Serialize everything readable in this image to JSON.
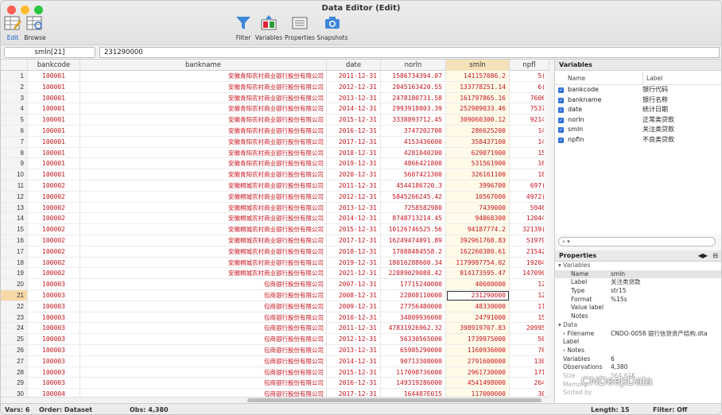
{
  "window": {
    "title": "Data Editor (Edit)"
  },
  "colors": {
    "accent": "#1a5fd0",
    "data_text": "#c8141e",
    "current_row": "#f7d9a8"
  },
  "toolbar": {
    "edit": "Edit",
    "browse": "Browse",
    "filter": "Filter",
    "variables": "Variables",
    "properties": "Properties",
    "snapshots": "Snapshots"
  },
  "cmd": {
    "varname": "smln[21]",
    "value": "231290000"
  },
  "grid": {
    "headers": [
      "bankcode",
      "bankname",
      "date",
      "norln",
      "smln",
      "npfl"
    ],
    "rows": [
      [
        "1",
        "100001",
        "安徽青阳农村商业银行股份有限公司",
        "2011-12-31",
        "1586734394.07",
        "141157086.2",
        "5("
      ],
      [
        "2",
        "100001",
        "安徽青阳农村商业银行股份有限公司",
        "2012-12-31",
        "2045163420.55",
        "133778251.14",
        "6("
      ],
      [
        "3",
        "100001",
        "安徽青阳农村商业银行股份有限公司",
        "2013-12-31",
        "2478180731.58",
        "161797865.16",
        "7606"
      ],
      [
        "4",
        "100001",
        "安徽青阳农村商业银行股份有限公司",
        "2014-12-31",
        "2993918803.39",
        "252989033.46",
        "7537"
      ],
      [
        "5",
        "100001",
        "安徽青阳农村商业银行股份有限公司",
        "2015-12-31",
        "3338893712.45",
        "309060300.12",
        "9214"
      ],
      [
        "6",
        "100001",
        "安徽青阳农村商业银行股份有限公司",
        "2016-12-31",
        "3747202700",
        "286625200",
        "14"
      ],
      [
        "7",
        "100001",
        "安徽青阳农村商业银行股份有限公司",
        "2017-12-31",
        "4153436000",
        "358437100",
        "14"
      ],
      [
        "8",
        "100001",
        "安徽青阳农村商业银行股份有限公司",
        "2018-12-31",
        "4281040200",
        "629071900",
        "15"
      ],
      [
        "9",
        "100001",
        "安徽青阳农村商业银行股份有限公司",
        "2019-12-31",
        "4866421800",
        "531561900",
        "16"
      ],
      [
        "10",
        "100001",
        "安徽青阳农村商业银行股份有限公司",
        "2020-12-31",
        "5607421300",
        "326161100",
        "18"
      ],
      [
        "11",
        "100002",
        "安徽桐城农村商业银行股份有限公司",
        "2011-12-31",
        "4544186720.3",
        "3996700",
        "697("
      ],
      [
        "12",
        "100002",
        "安徽桐城农村商业银行股份有限公司",
        "2012-12-31",
        "5845266245.42",
        "10567000",
        "4972("
      ],
      [
        "13",
        "100002",
        "安徽桐城农村商业银行股份有限公司",
        "2013-12-31",
        "7258582980",
        "7439000",
        "5946"
      ],
      [
        "14",
        "100002",
        "安徽桐城农村商业银行股份有限公司",
        "2014-12-31",
        "8748713214.45",
        "94868300",
        "12044"
      ],
      [
        "15",
        "100002",
        "安徽桐城农村商业银行股份有限公司",
        "2015-12-31",
        "10126746525.56",
        "94187774.2",
        "32139("
      ],
      [
        "16",
        "100002",
        "安徽桐城农村商业银行股份有限公司",
        "2017-12-31",
        "16249474891.89",
        "392961768.83",
        "51979"
      ],
      [
        "17",
        "100002",
        "安徽桐城农村商业银行股份有限公司",
        "2018-12-31",
        "17088484558.2",
        "162260380.61",
        "21542"
      ],
      [
        "18",
        "100002",
        "安徽桐城农村商业银行股份有限公司",
        "2019-12-31",
        "18016288600.34",
        "1179987754.02",
        "19204"
      ],
      [
        "19",
        "100002",
        "安徽桐城农村商业银行股份有限公司",
        "2021-12-31",
        "22889029088.42",
        "814173595.47",
        "147090"
      ],
      [
        "20",
        "100003",
        "包商银行股份有限公司",
        "2007-12-31",
        "17715240000",
        "40600000",
        "12"
      ],
      [
        "21",
        "100003",
        "包商银行股份有限公司",
        "2008-12-31",
        "22808110000",
        "231290000",
        "12"
      ],
      [
        "22",
        "100003",
        "包商银行股份有限公司",
        "2009-12-31",
        "27756480000",
        "48330000",
        "11"
      ],
      [
        "23",
        "100003",
        "包商银行股份有限公司",
        "2010-12-31",
        "34809936000",
        "24791000",
        "15"
      ],
      [
        "24",
        "100003",
        "包商银行股份有限公司",
        "2011-12-31",
        "47831926962.32",
        "398919707.83",
        "20995"
      ],
      [
        "25",
        "100003",
        "包商银行股份有限公司",
        "2012-12-31",
        "56330565000",
        "1739975000",
        "50"
      ],
      [
        "26",
        "100003",
        "包商银行股份有限公司",
        "2013-12-31",
        "65985290000",
        "1160936000",
        "70"
      ],
      [
        "27",
        "100003",
        "包商银行股份有限公司",
        "2014-12-31",
        "90713308000",
        "2791600000",
        "130"
      ],
      [
        "28",
        "100003",
        "包商银行股份有限公司",
        "2015-12-31",
        "117098736000",
        "2961730000",
        "171"
      ],
      [
        "29",
        "100003",
        "包商银行股份有限公司",
        "2016-12-31",
        "149319286000",
        "4541498000",
        "264"
      ],
      [
        "30",
        "100004",
        "包商银行股份有限公司",
        "2017-12-31",
        "164487E015",
        "117000000",
        "30"
      ]
    ]
  },
  "variables_panel": {
    "title": "Variables",
    "col_name": "Name",
    "col_label": "Label",
    "items": [
      {
        "name": "bankcode",
        "label": "银行代码"
      },
      {
        "name": "bankname",
        "label": "银行名称"
      },
      {
        "name": "date",
        "label": "统计日期"
      },
      {
        "name": "norln",
        "label": "正常类贷款"
      },
      {
        "name": "smln",
        "label": "关注类贷款"
      },
      {
        "name": "npfln",
        "label": "不良类贷款"
      }
    ],
    "search_icon": "magnifier-icon"
  },
  "properties_panel": {
    "title": "Properties",
    "variables_group": "Variables",
    "rows": [
      {
        "k": "Name",
        "v": "smln"
      },
      {
        "k": "Label",
        "v": "关注类贷款"
      },
      {
        "k": "Type",
        "v": "str15"
      },
      {
        "k": "Format",
        "v": "%15s"
      },
      {
        "k": "Value label",
        "v": ""
      },
      {
        "k": "Notes",
        "v": ""
      }
    ],
    "data_group": "Data",
    "data_rows": [
      {
        "k": "Filename",
        "v": "CNDO-0058 银行信贷资产结构.dta"
      },
      {
        "k": "Label",
        "v": ""
      },
      {
        "k": "Notes",
        "v": ""
      },
      {
        "k": "Variables",
        "v": "6"
      },
      {
        "k": "Observations",
        "v": "4,380"
      },
      {
        "k": "Size",
        "v": "564.61K"
      },
      {
        "k": "Memory",
        "v": ""
      },
      {
        "k": "Sorted by",
        "v": ""
      }
    ]
  },
  "status": {
    "vars": "Vars: 6",
    "order": "Order: Dataset",
    "obs": "Obs: 4,380",
    "length": "Length: 15",
    "filter": "Filter: Off"
  },
  "watermark": "CNDeepData"
}
